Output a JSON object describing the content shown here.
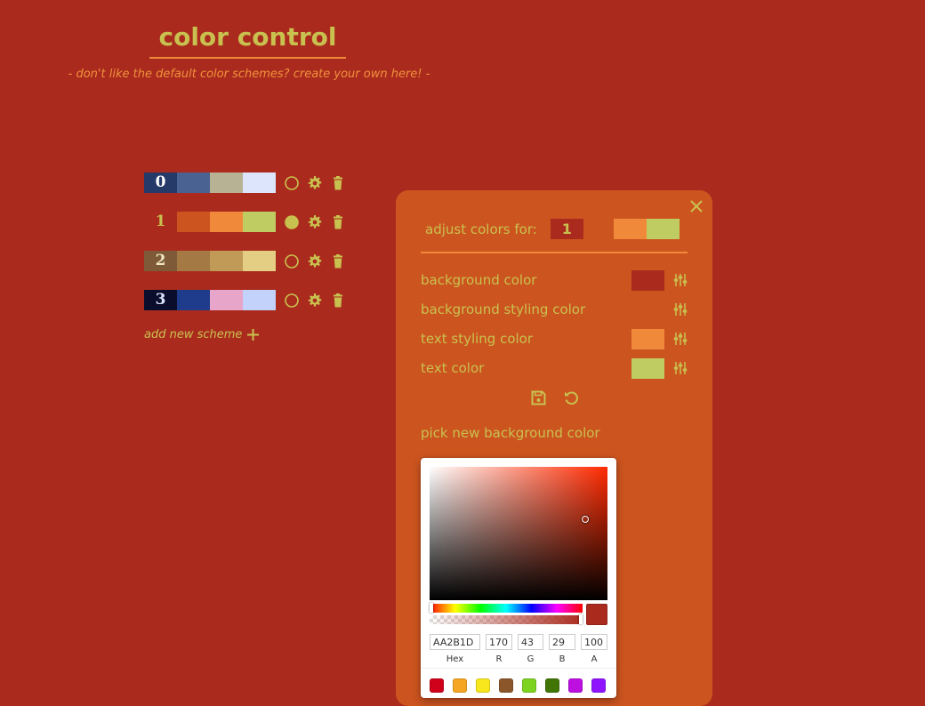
{
  "header": {
    "title": "color control",
    "subtitle": "- don't like the default color schemes? create your own here! -"
  },
  "schemes": [
    {
      "number": "0",
      "colors": [
        "#253A68",
        "#4A6291",
        "#B8B294",
        "#DCE5FB"
      ],
      "number_color": "#FFFFFF",
      "active": false
    },
    {
      "number": "1",
      "colors": [
        "#AA2B1D",
        "#CC541F",
        "#F08A3A",
        "#BFCC62"
      ],
      "number_color": "#C9C14F",
      "active": true
    },
    {
      "number": "2",
      "colors": [
        "#7E5A38",
        "#A47944",
        "#C29A58",
        "#E3CE84"
      ],
      "number_color": "#F0E5C0",
      "active": false
    },
    {
      "number": "3",
      "colors": [
        "#0A0E2C",
        "#1F3B8C",
        "#E7A5C9",
        "#C2D2FA"
      ],
      "number_color": "#DCE5FB",
      "active": false
    }
  ],
  "add_scheme_label": "add new scheme",
  "icons": {
    "radio_empty": "circle-outline-icon",
    "radio_filled": "circle-filled-icon",
    "settings": "gear-icon",
    "delete": "trash-icon",
    "add": "plus-icon",
    "close": "close-icon",
    "sliders": "sliders-icon",
    "save": "save-icon",
    "reset": "undo-icon"
  },
  "panel": {
    "adjust_label": "adjust colors for:",
    "scheme_number": "1",
    "preview_colors": [
      "#F08A3A",
      "#BFCC62"
    ],
    "rows": [
      {
        "label": "background color",
        "color": "#AA2B1D"
      },
      {
        "label": "background styling color",
        "color": "#CC541F"
      },
      {
        "label": "text styling color",
        "color": "#F08A3A"
      },
      {
        "label": "text color",
        "color": "#BFCC62"
      }
    ],
    "pick_label": "pick new background color"
  },
  "picker": {
    "hex": "AA2B1D",
    "r": "170",
    "g": "43",
    "b": "29",
    "a": "100",
    "labels": {
      "hex": "Hex",
      "r": "R",
      "g": "G",
      "b": "B",
      "a": "A"
    },
    "presets": [
      "#D0021B",
      "#F5A623",
      "#F8E71C",
      "#8B572A",
      "#7ED321",
      "#417505",
      "#BD10E0",
      "#9013FE"
    ]
  },
  "theme": {
    "background": "#AA2B1D",
    "panel": "#CC541F",
    "accent": "#F08A3A",
    "text": "#C9C14F"
  }
}
